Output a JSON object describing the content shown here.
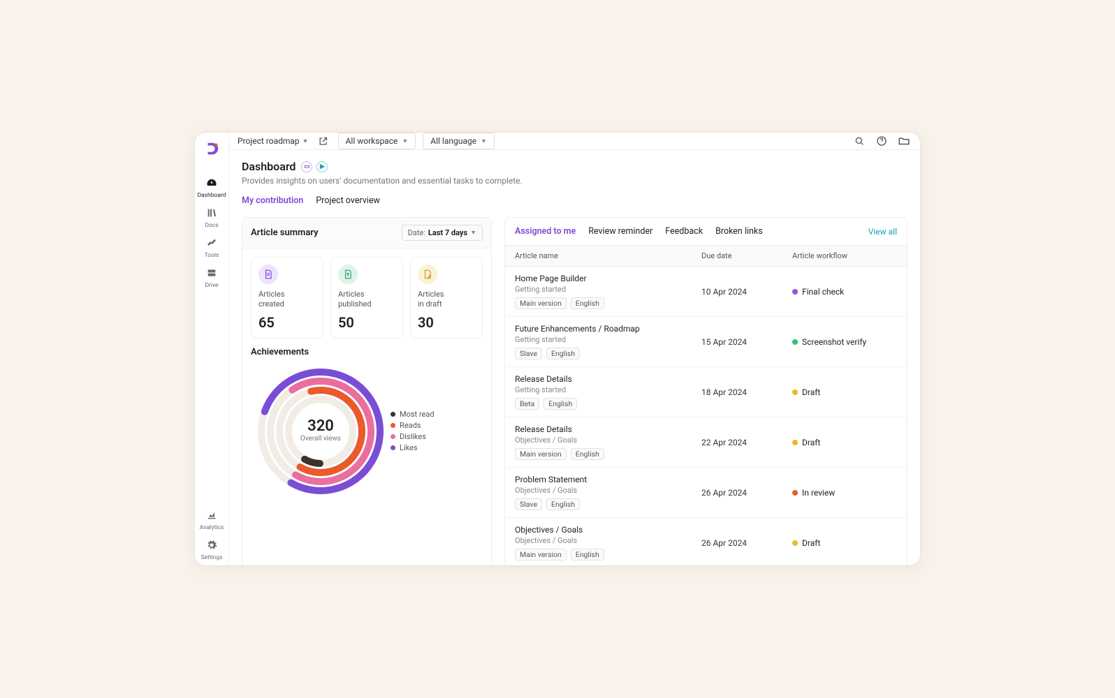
{
  "topbar": {
    "project": "Project roadmap",
    "workspace": "All workspace",
    "language": "All language"
  },
  "sidebar": {
    "items": [
      {
        "label": "Dashboard"
      },
      {
        "label": "Docs"
      },
      {
        "label": "Tools"
      },
      {
        "label": "Drive"
      },
      {
        "label": "Analytics"
      },
      {
        "label": "Settings"
      }
    ]
  },
  "page": {
    "title": "Dashboard",
    "subtitle": "Provides insights on users' documentation and essential tasks to complete."
  },
  "main_tabs": [
    {
      "label": "My contribution"
    },
    {
      "label": "Project overview"
    }
  ],
  "summary": {
    "title": "Article summary",
    "date_label": "Date:",
    "date_value": "Last 7 days",
    "stats": [
      {
        "label": "Articles\ncreated",
        "value": "65"
      },
      {
        "label": "Articles\npublished",
        "value": "50"
      },
      {
        "label": "Articles\nin draft",
        "value": "30"
      }
    ]
  },
  "achievements": {
    "title": "Achievements",
    "center_value": "320",
    "center_label": "Overall views",
    "legend": [
      {
        "label": "Most read",
        "color": "#3a342e"
      },
      {
        "label": "Reads",
        "color": "#ea5a2a"
      },
      {
        "label": "Dislikes",
        "color": "#ea6ea0"
      },
      {
        "label": "Likes",
        "color": "#7a4dd6"
      }
    ]
  },
  "tasks": {
    "tabs": [
      "Assigned to me",
      "Review reminder",
      "Feedback",
      "Broken links"
    ],
    "view_all": "View all",
    "columns": {
      "name": "Article name",
      "due": "Due date",
      "wf": "Article workflow"
    },
    "rows": [
      {
        "title": "Home Page Builder",
        "breadcrumb": "Getting started",
        "due": "10 Apr 2024",
        "workflow": "Final check",
        "wf_color": "#a44dd6",
        "chips": [
          "Main version",
          "English"
        ]
      },
      {
        "title": "Future Enhancements / Roadmap",
        "breadcrumb": "Getting started",
        "due": "15 Apr 2024",
        "workflow": "Screenshot verify",
        "wf_color": "#28c76f",
        "chips": [
          "Slave",
          "English"
        ]
      },
      {
        "title": "Release Details",
        "breadcrumb": "Getting started",
        "due": "18 Apr 2024",
        "workflow": "Draft",
        "wf_color": "#e8b92e",
        "chips": [
          "Beta",
          "English"
        ]
      },
      {
        "title": "Release Details",
        "breadcrumb": "Objectives / Goals",
        "due": "22 Apr 2024",
        "workflow": "Draft",
        "wf_color": "#e8b92e",
        "chips": [
          "Main version",
          "English"
        ]
      },
      {
        "title": "Problem Statement",
        "breadcrumb": "Objectives / Goals",
        "due": "26 Apr 2024",
        "workflow": "In review",
        "wf_color": "#ea5a2a",
        "chips": [
          "Slave",
          "English"
        ]
      },
      {
        "title": "Objectives / Goals",
        "breadcrumb": "Objectives / Goals",
        "due": "26 Apr 2024",
        "workflow": "Draft",
        "wf_color": "#e8b92e",
        "chips": [
          "Main version",
          "English"
        ]
      }
    ]
  },
  "chart_data": {
    "type": "radial-bar",
    "title": "Achievements",
    "center_value": 320,
    "center_label": "Overall views",
    "series": [
      {
        "name": "Most read",
        "percent": 8,
        "color": "#3a342e"
      },
      {
        "name": "Reads",
        "percent": 62,
        "color": "#ea5a2a"
      },
      {
        "name": "Dislikes",
        "percent": 68,
        "color": "#ea6ea0"
      },
      {
        "name": "Likes",
        "percent": 78,
        "color": "#7a4dd6"
      }
    ],
    "start_angle_deg": 210,
    "direction": "counter-clockwise",
    "full_circle": 360
  }
}
